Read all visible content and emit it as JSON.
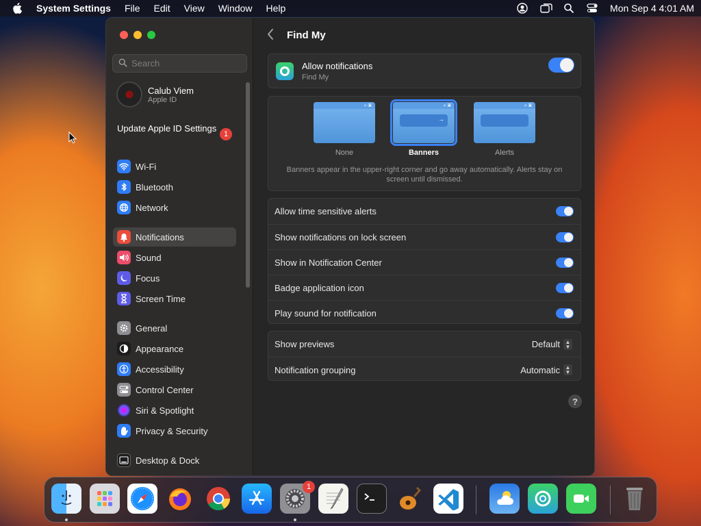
{
  "menubar": {
    "app_name": "System Settings",
    "items": [
      "File",
      "Edit",
      "View",
      "Window",
      "Help"
    ],
    "clock": "Mon Sep 4  4:01 AM",
    "status_icons": [
      "user-icon",
      "screen-mirroring-icon",
      "spotlight-search-icon",
      "control-center-icon"
    ]
  },
  "sidebar": {
    "search_placeholder": "Search",
    "account": {
      "name": "Calub Viem",
      "subtitle": "Apple ID"
    },
    "update": {
      "label": "Update Apple ID Settings",
      "badge": "1"
    },
    "items": [
      {
        "label": "Wi-Fi",
        "icon": "wifi-icon",
        "color": "#2f7cf6"
      },
      {
        "label": "Bluetooth",
        "icon": "bluetooth-icon",
        "color": "#2f7cf6"
      },
      {
        "label": "Network",
        "icon": "globe-icon",
        "color": "#2f7cf6"
      },
      {
        "label": "Notifications",
        "icon": "bell-icon",
        "color": "#eb4d3d"
      },
      {
        "label": "Sound",
        "icon": "speaker-icon",
        "color": "#eb4d6a"
      },
      {
        "label": "Focus",
        "icon": "moon-icon",
        "color": "#5e5ce6"
      },
      {
        "label": "Screen Time",
        "icon": "hourglass-icon",
        "color": "#5e5ce6"
      },
      {
        "label": "General",
        "icon": "gear-icon",
        "color": "#8e8e93"
      },
      {
        "label": "Appearance",
        "icon": "appearance-icon",
        "color": "#1c1c1e"
      },
      {
        "label": "Accessibility",
        "icon": "accessibility-icon",
        "color": "#2f7cf6"
      },
      {
        "label": "Control Center",
        "icon": "control-center-icon",
        "color": "#8e8e93"
      },
      {
        "label": "Siri & Spotlight",
        "icon": "siri-icon",
        "color": "#b042c6"
      },
      {
        "label": "Privacy & Security",
        "icon": "hand-icon",
        "color": "#2f7cf6"
      },
      {
        "label": "Desktop & Dock",
        "icon": "dock-icon",
        "color": "#1c1c1e"
      }
    ],
    "selected": "Notifications"
  },
  "main": {
    "title": "Find My",
    "allow": {
      "label": "Allow notifications",
      "subtitle": "Find My",
      "on": true
    },
    "alert_styles": {
      "options": [
        "None",
        "Banners",
        "Alerts"
      ],
      "selected": "Banners",
      "description": "Banners appear in the upper-right corner and go away automatically. Alerts stay on screen until dismissed."
    },
    "toggles": [
      {
        "label": "Allow time sensitive alerts",
        "on": true
      },
      {
        "label": "Show notifications on lock screen",
        "on": true
      },
      {
        "label": "Show in Notification Center",
        "on": true
      },
      {
        "label": "Badge application icon",
        "on": true
      },
      {
        "label": "Play sound for notification",
        "on": true
      }
    ],
    "selects": [
      {
        "label": "Show previews",
        "value": "Default"
      },
      {
        "label": "Notification grouping",
        "value": "Automatic"
      }
    ],
    "help": "?"
  },
  "dock": {
    "apps": [
      {
        "name": "Finder",
        "icon": "finder-icon",
        "running": true
      },
      {
        "name": "Launchpad",
        "icon": "launchpad-icon",
        "running": false
      },
      {
        "name": "Safari",
        "icon": "safari-icon",
        "running": false
      },
      {
        "name": "Firefox",
        "icon": "firefox-icon",
        "running": false
      },
      {
        "name": "Chrome",
        "icon": "chrome-icon",
        "running": false
      },
      {
        "name": "App Store",
        "icon": "app-store-icon",
        "running": false
      },
      {
        "name": "System Settings",
        "icon": "system-settings-icon",
        "running": true,
        "badge": "1"
      },
      {
        "name": "TextEdit",
        "icon": "textedit-icon",
        "running": false
      },
      {
        "name": "Terminal",
        "icon": "terminal-icon",
        "running": false
      },
      {
        "name": "GarageBand",
        "icon": "garageband-icon",
        "running": false
      },
      {
        "name": "Visual Studio Code",
        "icon": "vscode-icon",
        "running": false
      },
      {
        "name": "Weather",
        "icon": "weather-icon",
        "running": false
      },
      {
        "name": "Find My",
        "icon": "find-my-icon",
        "running": false
      },
      {
        "name": "FaceTime",
        "icon": "facetime-icon",
        "running": false
      },
      {
        "name": "Trash",
        "icon": "trash-icon",
        "running": false
      }
    ]
  }
}
